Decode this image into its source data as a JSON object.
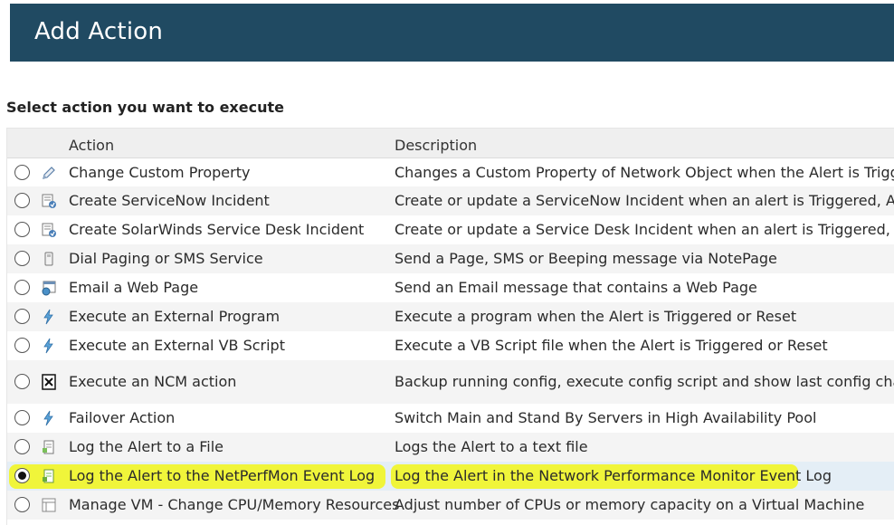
{
  "header": {
    "title": "Add Action"
  },
  "section_title": "Select action you want to execute",
  "grid": {
    "columns": {
      "action": "Action",
      "description": "Description"
    },
    "selected_index": 10,
    "highlight_color": "#f0f53a",
    "rows": [
      {
        "action": "Change Custom Property",
        "description": "Changes a Custom Property of Network Object when the Alert is Triggered o",
        "icon": "pencil-icon"
      },
      {
        "action": "Create ServiceNow Incident",
        "description": "Create or update a ServiceNow Incident when an alert is Triggered, Acknowle",
        "icon": "incident-icon"
      },
      {
        "action": "Create SolarWinds Service Desk Incident",
        "description": "Create or update a Service Desk Incident when an alert is Triggered, Acknow",
        "icon": "incident-icon"
      },
      {
        "action": "Dial Paging or SMS Service",
        "description": "Send a Page, SMS or Beeping message via NotePage",
        "icon": "pager-icon"
      },
      {
        "action": "Email a Web Page",
        "description": "Send an Email message that contains a Web Page",
        "icon": "web-page-icon"
      },
      {
        "action": "Execute an External Program",
        "description": "Execute a program when the Alert is Triggered or Reset",
        "icon": "lightning-icon"
      },
      {
        "action": "Execute an External VB Script",
        "description": "Execute a VB Script file when the Alert is Triggered or Reset",
        "icon": "lightning-icon"
      },
      {
        "action": "Execute an NCM action",
        "description": "Backup running config, execute config script and show last config changes",
        "icon": "ncm-icon"
      },
      {
        "action": "Failover Action",
        "description": "Switch Main and Stand By Servers in High Availability Pool",
        "icon": "lightning-icon"
      },
      {
        "action": "Log the Alert to a File",
        "description": "Logs the Alert to a text file",
        "icon": "log-file-icon"
      },
      {
        "action": "Log the Alert to the NetPerfMon Event Log",
        "description": "Log the Alert in the Network Performance Monitor Event Log",
        "icon": "event-log-icon"
      },
      {
        "action": "Manage VM - Change CPU/Memory Resources",
        "description": "Adjust number of CPUs or memory capacity on a Virtual Machine",
        "icon": "vm-icon"
      }
    ]
  }
}
